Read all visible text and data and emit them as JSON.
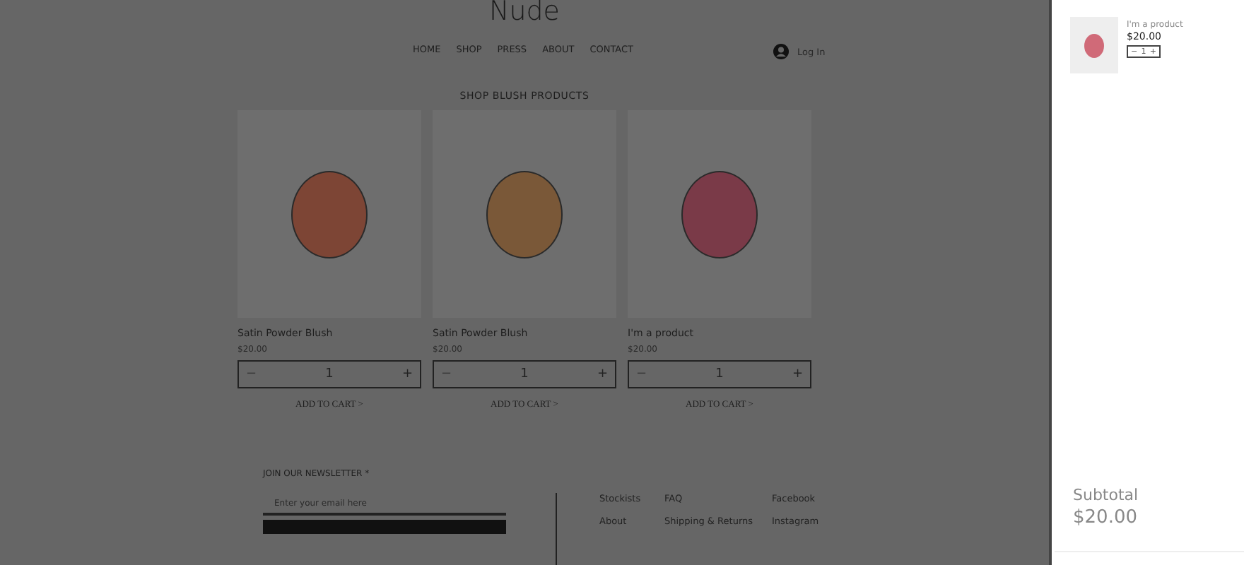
{
  "header": {
    "logo": "Nude",
    "nav": [
      {
        "label": "HOME"
      },
      {
        "label": "SHOP"
      },
      {
        "label": "PRESS"
      },
      {
        "label": "ABOUT"
      },
      {
        "label": "CONTACT"
      }
    ],
    "login": "Log In"
  },
  "section_title": "SHOP BLUSH PRODUCTS",
  "products": [
    {
      "name": "Satin Powder Blush",
      "price": "$20.00",
      "color": "#7d4535",
      "stepper": {
        "minus": "−",
        "value": "1",
        "plus": "+"
      },
      "add_to_cart": "ADD TO CART >"
    },
    {
      "name": "Satin Powder Blush",
      "price": "$20.00",
      "color": "#7a5838",
      "stepper": {
        "minus": "−",
        "value": "1",
        "plus": "+"
      },
      "add_to_cart": "ADD TO CART >"
    },
    {
      "name": "I'm a product",
      "price": "$20.00",
      "color": "#7a3a48",
      "stepper": {
        "minus": "−",
        "value": "1",
        "plus": "+"
      },
      "add_to_cart": "ADD TO CART >"
    }
  ],
  "newsletter": {
    "label": "JOIN OUR NEWSLETTER *",
    "placeholder": "Enter your email here"
  },
  "footer_links": [
    [
      "Stockists",
      "About"
    ],
    [
      "FAQ",
      "Shipping & Returns"
    ],
    [
      "Facebook",
      "Instagram"
    ]
  ],
  "cart": {
    "items": [
      {
        "name": "I'm a product",
        "price": "$20.00",
        "color": "#d06a78",
        "stepper": {
          "minus": "−",
          "value": "1",
          "plus": "+"
        }
      }
    ],
    "subtotal_label": "Subtotal",
    "subtotal": "$20.00"
  }
}
